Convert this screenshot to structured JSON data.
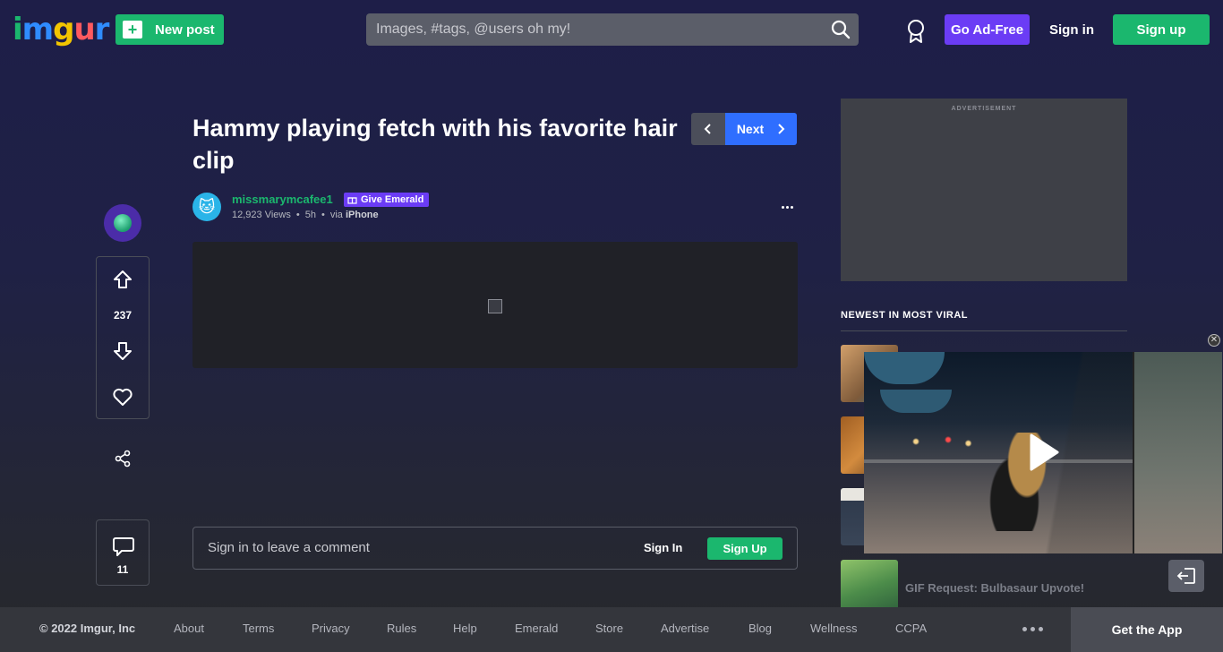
{
  "header": {
    "logo_text": "imgur",
    "new_post_label": "New post",
    "search_placeholder": "Images, #tags, @users oh my!",
    "go_adfree_label": "Go Ad-Free",
    "sign_in_label": "Sign in",
    "sign_up_label": "Sign up"
  },
  "post": {
    "title": "Hammy playing fetch with his favorite hair clip",
    "next_label": "Next",
    "username": "missmarymcafee1",
    "give_emerald_label": "Give Emerald",
    "views": "12,923 Views",
    "age": "5h",
    "via_prefix": "via",
    "via_device": "iPhone",
    "upvote_count": "237",
    "comment_count": "11"
  },
  "comment_bar": {
    "prompt": "Sign in to leave a comment",
    "sign_in_label": "Sign In",
    "sign_up_label": "Sign Up"
  },
  "sidebar": {
    "ad_label": "ADVERTISEMENT",
    "section_title": "NEWEST IN MOST VIRAL",
    "items": [
      {
        "title": ""
      },
      {
        "title": ""
      },
      {
        "title": ""
      },
      {
        "title": "GIF Request: Bulbasaur Upvote!"
      }
    ]
  },
  "footer": {
    "copyright": "© 2022 Imgur, Inc",
    "links": [
      "About",
      "Terms",
      "Privacy",
      "Rules",
      "Help",
      "Emerald",
      "Store",
      "Advertise",
      "Blog",
      "Wellness",
      "CCPA"
    ],
    "get_app_label": "Get the App"
  },
  "colors": {
    "brand_green": "#1bb76e",
    "accent_purple": "#6b3cf5",
    "next_blue": "#2f6eff",
    "background_top": "#1e1e48"
  },
  "icons": [
    "plus-icon",
    "search-icon",
    "award-icon",
    "chevron-left-icon",
    "chevron-right-icon",
    "emerald-icon",
    "upvote-icon",
    "downvote-icon",
    "heart-icon",
    "share-icon",
    "comment-icon",
    "more-icon",
    "play-icon",
    "exit-icon",
    "close-icon"
  ]
}
